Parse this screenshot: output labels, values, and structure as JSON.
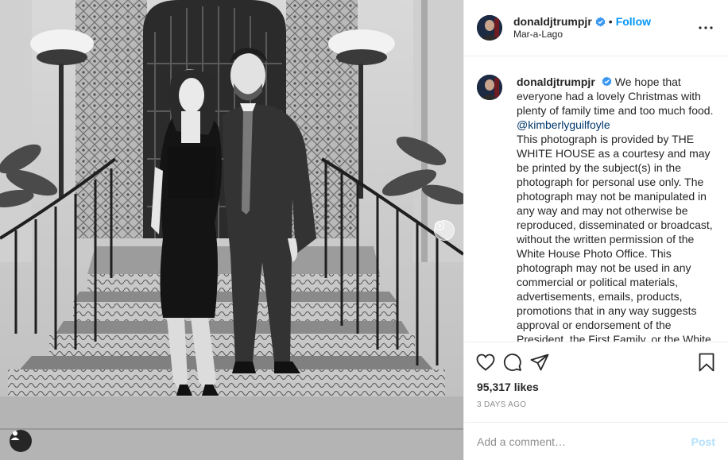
{
  "post": {
    "username": "donaldjtrumpjr",
    "verified": true,
    "follow_label": "Follow",
    "separator": "•",
    "location": "Mar-a-Lago",
    "more_icon": "more-horizontal-icon"
  },
  "caption": {
    "username": "donaldjtrumpjr",
    "text_before_mention": "We hope that everyone had a lovely Christmas with plenty of family time and too much food.",
    "mention": "@kimberlyguilfoyle",
    "text_after_mention": "This photograph is provided by THE WHITE HOUSE as a courtesy and may be printed by the subject(s) in the photograph for personal use only. The photograph may not be manipulated in any way and may not otherwise be reproduced, disseminated or broadcast, without the written permission of the White House Photo Office. This photograph may not be used in any commercial or political materials, advertisements, emails, products, promotions that in any way suggests approval or endorsement of the President, the First Family, or the White House."
  },
  "actions": {
    "like_icon": "heart-icon",
    "comment_icon": "comment-icon",
    "share_icon": "share-icon",
    "save_icon": "bookmark-icon",
    "likes": "95,317 likes",
    "timestamp": "3 DAYS AGO"
  },
  "comment": {
    "placeholder": "Add a comment…",
    "post_label": "Post"
  },
  "colors": {
    "accent": "#0095f6",
    "verified": "#3897f0",
    "post_disabled": "#b2dffc",
    "mention": "#00376b"
  }
}
